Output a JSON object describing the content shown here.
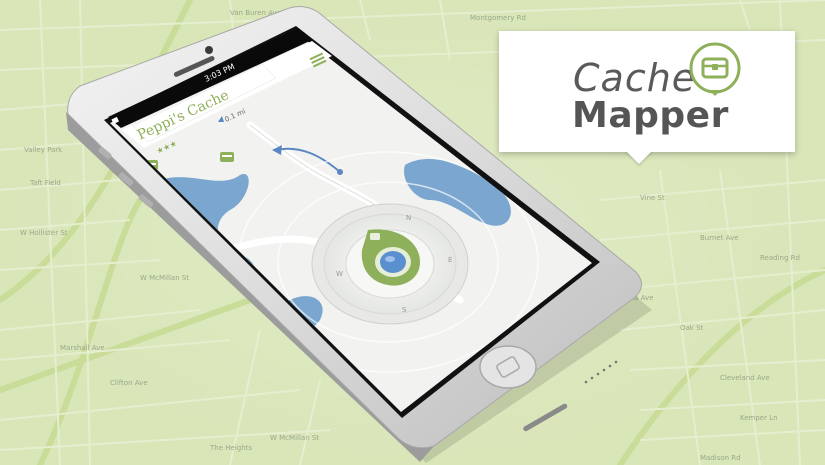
{
  "status_bar": {
    "time": "3:03 PM"
  },
  "app": {
    "cache_title": "Peppi's Cache",
    "distance": "0.1 mi",
    "menu_icon": "hamburger-icon",
    "compass_directions": [
      "N",
      "E",
      "S",
      "W"
    ]
  },
  "brand": {
    "line1": "Cache",
    "line2": "Mapper",
    "icon": "treasure-chest-icon",
    "accent_color": "#8eb05a",
    "text_color": "#555555"
  },
  "map_labels": {
    "streets": [
      "Valley Park",
      "Taft Field",
      "W McMillan St",
      "Marshall Ave",
      "Clifton Ave",
      "Vine St",
      "Burnet Ave",
      "Reading Rd",
      "W Hollister St",
      "Oak St",
      "Cleveland Ave",
      "Kemper Ln",
      "Montgomery Rd",
      "Dana Ave",
      "Madison Rd",
      "Van Buren Ave",
      "The Heights",
      "W McMillan St"
    ]
  },
  "colors": {
    "map_background": "#d9e6b8",
    "phone_body": "#e6e6e6",
    "app_green": "#8eb05a",
    "water": "#7aa6cf"
  }
}
